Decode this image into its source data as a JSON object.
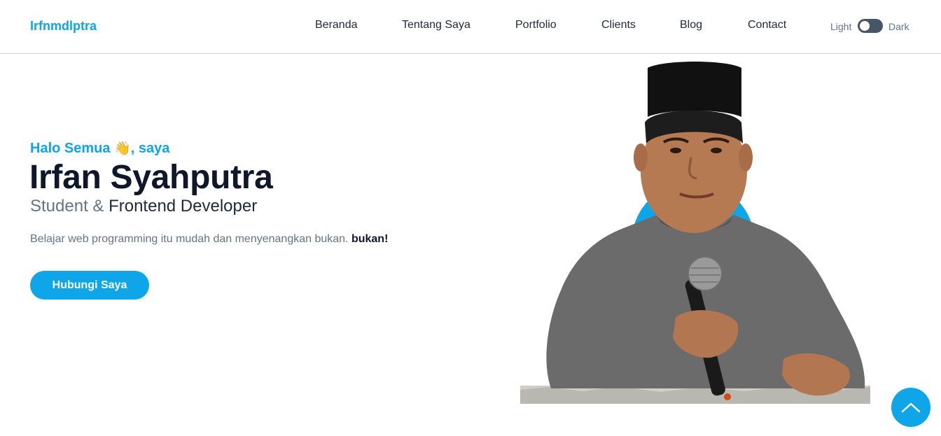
{
  "brand": "Irfnmdlptra",
  "nav": {
    "items": [
      "Beranda",
      "Tentang Saya",
      "Portfolio",
      "Clients",
      "Blog",
      "Contact"
    ]
  },
  "theme": {
    "light_label": "Light",
    "dark_label": "Dark"
  },
  "hero": {
    "greeting_prefix": "Halo Semua ",
    "greeting_emoji": "👋",
    "greeting_suffix": ", saya",
    "name": "Irfan Syahputra",
    "role_first": "Student & ",
    "role_second": "Frontend Developer",
    "tagline": "Belajar web programming itu mudah dan menyenangkan bukan. ",
    "tagline_bold": "bukan!",
    "cta_label": "Hubungi Saya"
  },
  "colors": {
    "accent": "#0ea5e9",
    "heading": "#0f172a",
    "muted": "#64748b",
    "toggle": "#475569"
  },
  "icons": {
    "back_to_top": "chevron-up-icon",
    "wave": "waving-hand-icon"
  }
}
